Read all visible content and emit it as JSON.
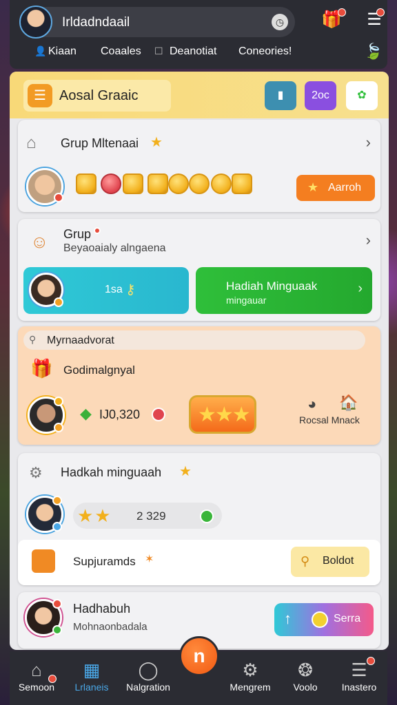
{
  "header": {
    "app_title": "Irldadndaail",
    "pill_icon": "clock-icon",
    "subnav": [
      {
        "label": "Kiaan",
        "icon": "person-icon"
      },
      {
        "label": "Coaales",
        "icon": ""
      },
      {
        "label": "Deanotiat",
        "icon": "checkbox-icon"
      },
      {
        "label": "Coneories!",
        "icon": ""
      }
    ]
  },
  "top_card": {
    "title": "Aosal Graaic",
    "btn_purple": "2oc"
  },
  "group_card": {
    "title": "Grup Mltenaai",
    "action_label": "Aarroh"
  },
  "grup2_card": {
    "title": "Grup",
    "subtitle": "Beyaoaialy alngaena",
    "cyan_value": "1sa",
    "green_title": "Hadiah Minguaak",
    "green_subtitle": "mingauar"
  },
  "orange_card": {
    "search_label": "Myrnaadvorat",
    "subtitle": "Godimalgnyal",
    "amount": "I​J0,320",
    "side_label": "Rocsal Mnack"
  },
  "weekly_card": {
    "title": "Hadkah minguaah",
    "value": "2 329",
    "row_label": "Supjuramds",
    "row_button": "Boldot"
  },
  "last_card": {
    "title": "Hadhabuh",
    "subtitle": "Mohnaonbadala",
    "button_label": "Serra"
  },
  "navbar": {
    "items": [
      {
        "label": "Semoon",
        "icon": "home-icon"
      },
      {
        "label": "Lrlaneis",
        "icon": "shop-icon"
      },
      {
        "label": "Nalgration",
        "icon": "globe-icon"
      },
      {
        "label": "Mengrem",
        "icon": "settings-icon"
      },
      {
        "label": "Voolo",
        "icon": "gear-icon"
      },
      {
        "label": "Inastero",
        "icon": "menu-icon"
      }
    ],
    "center_icon": "n"
  },
  "colors": {
    "accent_orange": "#f29b24",
    "accent_blue": "#4aa8e8",
    "green": "#2fbf3a",
    "cyan": "#2fc9d6"
  }
}
